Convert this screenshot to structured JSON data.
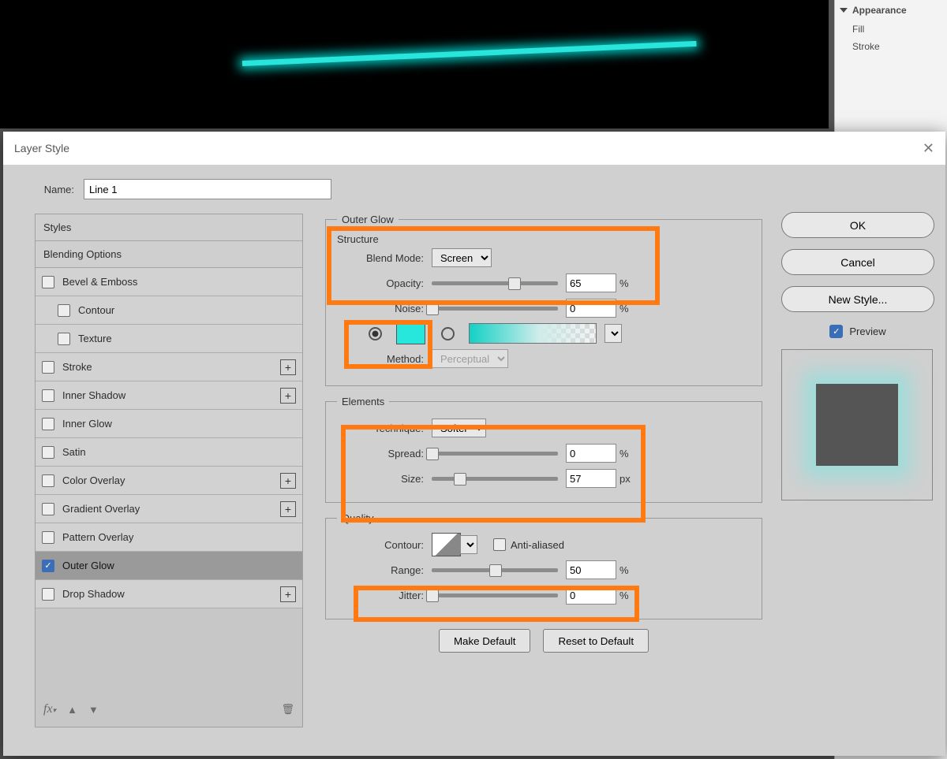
{
  "appearance": {
    "header": "Appearance",
    "fill_label": "Fill",
    "stroke_label": "Stroke"
  },
  "dialog": {
    "title": "Layer Style",
    "name_label": "Name:",
    "name_value": "Line 1",
    "styles_header": "Styles",
    "blending_header": "Blending Options",
    "effects": {
      "bevel": "Bevel & Emboss",
      "contour": "Contour",
      "texture": "Texture",
      "stroke": "Stroke",
      "inner_shadow": "Inner Shadow",
      "inner_glow": "Inner Glow",
      "satin": "Satin",
      "color_overlay": "Color Overlay",
      "gradient_overlay": "Gradient Overlay",
      "pattern_overlay": "Pattern Overlay",
      "outer_glow": "Outer Glow",
      "drop_shadow": "Drop Shadow"
    },
    "buttons": {
      "ok": "OK",
      "cancel": "Cancel",
      "new_style": "New Style...",
      "preview": "Preview",
      "make_default": "Make Default",
      "reset_default": "Reset to Default"
    },
    "outer_glow": {
      "legend": "Outer Glow",
      "structure_legend": "Structure",
      "blend_mode_label": "Blend Mode:",
      "blend_mode_value": "Screen",
      "opacity_label": "Opacity:",
      "opacity_value": "65",
      "noise_label": "Noise:",
      "noise_value": "0",
      "method_label": "Method:",
      "method_value": "Perceptual",
      "color_hex": "#27e6dc",
      "elements_legend": "Elements",
      "technique_label": "Technique:",
      "technique_value": "Softer",
      "spread_label": "Spread:",
      "spread_value": "0",
      "size_label": "Size:",
      "size_value": "57",
      "quality_legend": "Quality",
      "contour_label": "Contour:",
      "antialias_label": "Anti-aliased",
      "range_label": "Range:",
      "range_value": "50",
      "jitter_label": "Jitter:",
      "jitter_value": "0",
      "pct": "%",
      "px": "px"
    }
  }
}
